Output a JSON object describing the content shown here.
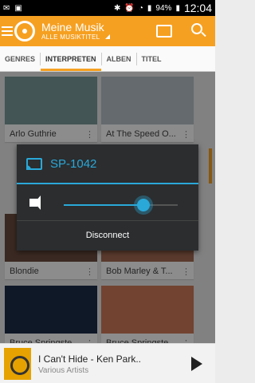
{
  "statusbar": {
    "battery": "94%",
    "time": "12:04"
  },
  "appbar": {
    "title": "Meine Musik",
    "subtitle": "ALLE MUSIKTITEL"
  },
  "tabs": [
    {
      "label": "GENRES"
    },
    {
      "label": "INTERPRETEN",
      "active": true
    },
    {
      "label": "ALBEN"
    },
    {
      "label": "TITEL"
    }
  ],
  "cards": [
    {
      "label": "Arlo Guthrie",
      "art_color": "#7b9b9a"
    },
    {
      "label": "At The Speed O...",
      "art_color": "#b6c1c9"
    },
    {
      "label": "Blondie",
      "art_color": "#6b4b3e"
    },
    {
      "label": "Bob Marley & T...",
      "art_color": "#a56b52"
    },
    {
      "label": "Bruce Springste...",
      "art_color": "#1d2c48"
    },
    {
      "label": "Bruce Springste...",
      "art_color": "#d07a5a"
    }
  ],
  "dialog": {
    "device_name": "SP-1042",
    "volume_percent": 70,
    "disconnect_label": "Disconnect"
  },
  "nowplaying": {
    "title": "I Can't Hide - Ken Park..",
    "artist": "Various Artists"
  },
  "colors": {
    "accent": "#f6a021",
    "cast_blue": "#2aa8d8"
  }
}
